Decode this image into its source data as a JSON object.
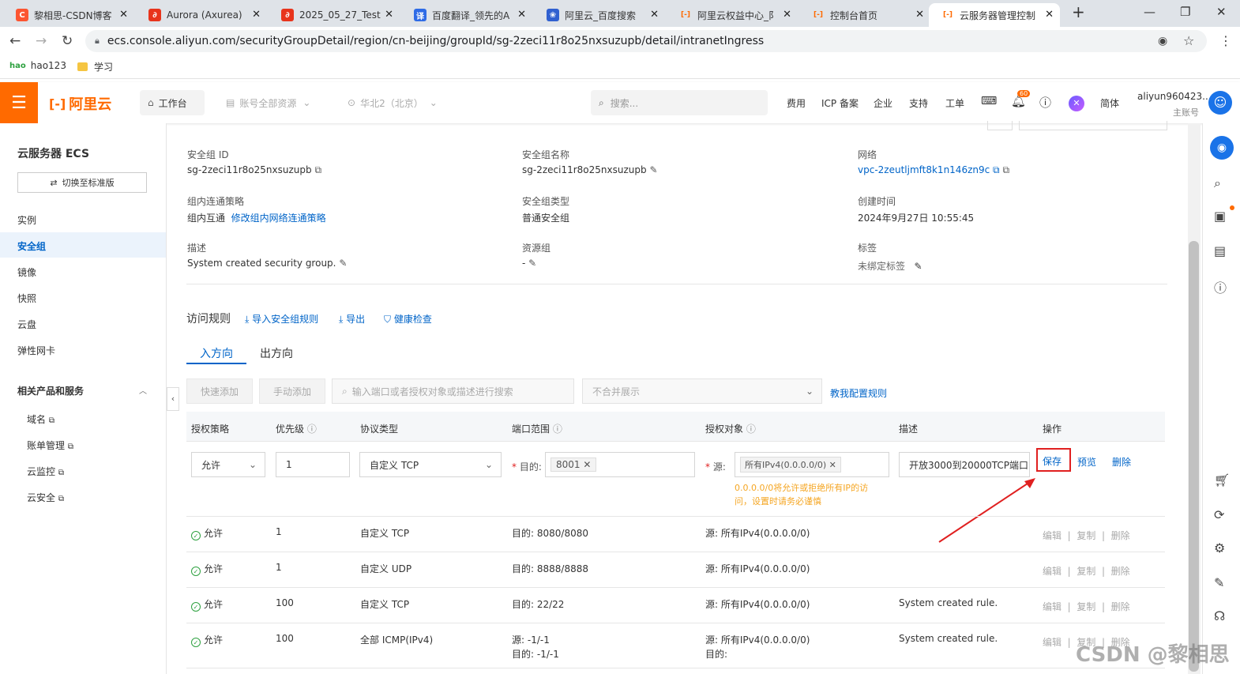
{
  "browser": {
    "tabs": [
      {
        "label": "黎相思-CSDN博客",
        "fav": "C",
        "color": "#fc5531"
      },
      {
        "label": "Aurora (Axurea)",
        "fav": "∂",
        "color": "#e8341c"
      },
      {
        "label": "2025_05_27_Test",
        "fav": "∂",
        "color": "#e8341c"
      },
      {
        "label": "百度翻译_领先的A",
        "fav": "译",
        "color": "#2e6be6"
      },
      {
        "label": "阿里云_百度搜索",
        "fav": "❀",
        "color": "#3060d0"
      },
      {
        "label": "阿里云权益中心_阝",
        "fav": "[-]",
        "color": "#ff6a00"
      },
      {
        "label": "控制台首页",
        "fav": "[-]",
        "color": "#ff6a00"
      },
      {
        "label": "云服务器管理控制",
        "fav": "[-]",
        "color": "#ff6a00"
      }
    ],
    "url": "ecs.console.aliyun.com/securityGroupDetail/region/cn-beijing/groupId/sg-2zeci11r8o25nxsuzupb/detail/intranetIngress",
    "bookmarks": [
      "hao123",
      "学习"
    ]
  },
  "header": {
    "logo": "阿里云",
    "workbench": "工作台",
    "resources": "账号全部资源",
    "region": "华北2（北京）",
    "search_placeholder": "搜索...",
    "links": [
      "费用",
      "ICP 备案",
      "企业",
      "支持",
      "工单"
    ],
    "notif_count": "60",
    "lang": "简体",
    "account": "aliyun960423...",
    "account_role": "主账号"
  },
  "sidebar": {
    "title": "云服务器 ECS",
    "switch_btn": "切换至标准版",
    "items": [
      "实例",
      "安全组",
      "镜像",
      "快照",
      "云盘",
      "弹性网卡"
    ],
    "related_title": "相关产品和服务",
    "related": [
      "域名",
      "账单管理",
      "云监控",
      "云安全"
    ]
  },
  "detail": {
    "sg_id_label": "安全组 ID",
    "sg_id": "sg-2zeci11r8o25nxsuzupb",
    "sg_name_label": "安全组名称",
    "sg_name": "sg-2zeci11r8o25nxsuzupb",
    "network_label": "网络",
    "network": "vpc-2zeutljmft8k1n146zn9c",
    "policy_label": "组内连通策略",
    "policy": "组内互通",
    "policy_link": "修改组内网络连通策略",
    "type_label": "安全组类型",
    "type": "普通安全组",
    "created_label": "创建时间",
    "created": "2024年9月27日 10:55:45",
    "desc_label": "描述",
    "desc": "System created security group.",
    "rg_label": "资源组",
    "rg": "-",
    "tag_label": "标签",
    "tag": "未绑定标签"
  },
  "rules": {
    "title": "访问规则",
    "actions": [
      "导入安全组规则",
      "导出",
      "健康检查"
    ],
    "tab_in": "入方向",
    "tab_out": "出方向",
    "quick_add": "快速添加",
    "manual_add": "手动添加",
    "search_placeholder": "输入端口或者授权对象或描述进行搜索",
    "merge": "不合并展示",
    "help": "教我配置规则",
    "headers": [
      "授权策略",
      "优先级",
      "协议类型",
      "端口范围",
      "授权对象",
      "描述",
      "操作"
    ],
    "edit_row": {
      "policy": "允许",
      "priority": "1",
      "protocol": "自定义 TCP",
      "port_prefix": "目的:",
      "port_tag": "8001",
      "src_prefix": "源:",
      "src_tag": "所有IPv4(0.0.0.0/0)",
      "warning": "0.0.0.0/0将允许或拒绝所有IP的访问，设置时请务必谨慎",
      "desc": "开放3000到20000TCP端口",
      "save": "保存",
      "preview": "预览",
      "delete": "删除"
    },
    "rows": [
      {
        "policy": "允许",
        "priority": "1",
        "protocol": "自定义 TCP",
        "port": "目的: 8080/8080",
        "port2": "",
        "src": "源: 所有IPv4(0.0.0.0/0)",
        "src2": "",
        "desc": ""
      },
      {
        "policy": "允许",
        "priority": "1",
        "protocol": "自定义 UDP",
        "port": "目的: 8888/8888",
        "port2": "",
        "src": "源: 所有IPv4(0.0.0.0/0)",
        "src2": "",
        "desc": ""
      },
      {
        "policy": "允许",
        "priority": "100",
        "protocol": "自定义 TCP",
        "port": "目的: 22/22",
        "port2": "",
        "src": "源: 所有IPv4(0.0.0.0/0)",
        "src2": "",
        "desc": "System created rule."
      },
      {
        "policy": "允许",
        "priority": "100",
        "protocol": "全部 ICMP(IPv4)",
        "port": "源: -1/-1",
        "port2": "目的: -1/-1",
        "src": "源: 所有IPv4(0.0.0.0/0)",
        "src2": "目的:",
        "desc": "System created rule."
      }
    ],
    "row_ops": [
      "编辑",
      "复制",
      "删除"
    ]
  },
  "watermark": "CSDN @黎相思"
}
